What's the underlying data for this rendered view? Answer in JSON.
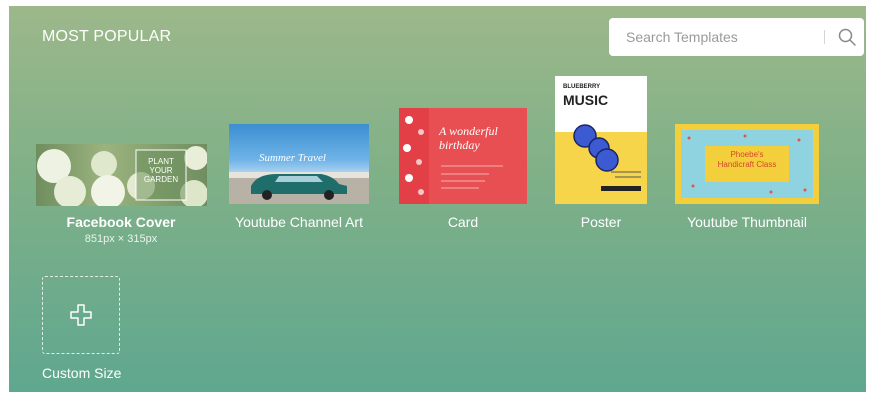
{
  "section_title": "MOST POPULAR",
  "search": {
    "placeholder": "Search Templates",
    "icon": "search-icon"
  },
  "templates": [
    {
      "label": "Facebook Cover",
      "sublabel": "851px × 315px",
      "thumb_text": [
        "PLANT",
        "YOUR",
        "GARDEN"
      ]
    },
    {
      "label": "Youtube Channel Art",
      "thumb_text": [
        "Summer Travel"
      ]
    },
    {
      "label": "Card",
      "thumb_text": [
        "A wonderful",
        "birthday"
      ]
    },
    {
      "label": "Poster",
      "thumb_text": [
        "BLUEBERRY",
        "MUSIC"
      ]
    },
    {
      "label": "Youtube Thumbnail",
      "thumb_text": [
        "Phoebe's",
        "Handicraft Class"
      ]
    }
  ],
  "custom_size": {
    "label": "Custom Size",
    "icon": "plus-icon"
  },
  "colors": {
    "gradient_top": "#9cb88a",
    "gradient_bottom": "#5fa78f",
    "card_red": "#e84f52",
    "poster_yellow": "#f7d54a",
    "thumbnail_yellow": "#f3cf3c",
    "thumbnail_blue": "#8fd3e0"
  }
}
